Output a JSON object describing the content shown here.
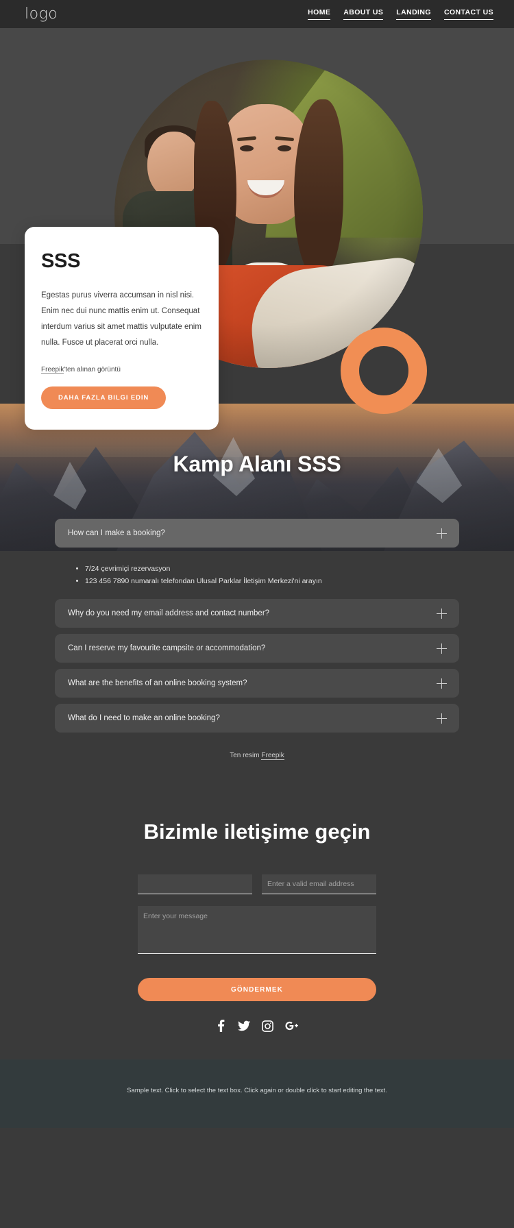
{
  "header": {
    "logo": "logo",
    "nav": [
      {
        "label": "HOME"
      },
      {
        "label": "ABOUT US"
      },
      {
        "label": "LANDING"
      },
      {
        "label": "CONTACT US"
      }
    ]
  },
  "hero": {
    "card": {
      "title": "SSS",
      "body": "Egestas purus viverra accumsan in nisl nisi. Enim nec dui nunc mattis enim ut. Consequat interdum varius sit amet mattis vulputate enim nulla. Fusce ut placerat orci nulla.",
      "credit_link": "Freepik",
      "credit_rest": "'ten alınan görüntü",
      "button": "DAHA FAZLA BILGI EDIN"
    },
    "accent_color": "#f08a55",
    "ring_color": "#f18e54"
  },
  "banner": {
    "title": "Kamp Alanı SSS"
  },
  "faq": {
    "items": [
      {
        "question": "How can I make a booking?",
        "open": true,
        "answers": [
          "7/24 çevrimiçi rezervasyon",
          "123 456 7890 numaralı telefondan Ulusal Parklar İletişim Merkezi'ni arayın"
        ]
      },
      {
        "question": "Why do you need my email address and contact number?",
        "open": false
      },
      {
        "question": "Can I reserve my favourite campsite or accommodation?",
        "open": false
      },
      {
        "question": "What are the benefits of an online booking system?",
        "open": false
      },
      {
        "question": "What do I need to make an online booking?",
        "open": false
      }
    ],
    "credit_prefix": "Ten resim ",
    "credit_link": "Freepik"
  },
  "contact": {
    "title": "Bizimle iletişime geçin",
    "name_value": "",
    "name_placeholder": "",
    "email_placeholder": "Enter a valid email address",
    "message_placeholder": "Enter your message",
    "submit_label": "GÖNDERMEK",
    "socials": [
      {
        "name": "facebook"
      },
      {
        "name": "twitter"
      },
      {
        "name": "instagram"
      },
      {
        "name": "google-plus"
      }
    ]
  },
  "footer": {
    "text": "Sample text. Click to select the text box. Click again or double click to start editing the text."
  }
}
